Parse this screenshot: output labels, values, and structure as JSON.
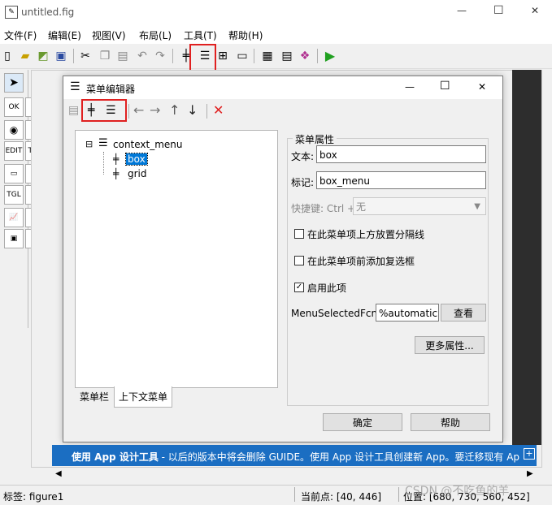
{
  "window": {
    "title": "untitled.fig",
    "minimize": "—",
    "maximize": "☐",
    "close": "✕"
  },
  "menubar": [
    {
      "label": "文件(F)"
    },
    {
      "label": "编辑(E)"
    },
    {
      "label": "视图(V)"
    },
    {
      "label": "布局(L)"
    },
    {
      "label": "工具(T)"
    },
    {
      "label": "帮助(H)"
    }
  ],
  "dialog": {
    "title": "菜单编辑器",
    "tree": {
      "root": "context_menu",
      "expander": "⊟",
      "children": [
        {
          "label": "box"
        },
        {
          "label": "grid"
        }
      ]
    },
    "tabs": {
      "menubar": "菜单栏",
      "context": "上下文菜单"
    },
    "group_title": "菜单属性",
    "text_label": "文本:",
    "text_value": "box",
    "tag_label": "标记:",
    "tag_value": "box_menu",
    "shortcut_label": "快捷键: Ctrl +",
    "shortcut_value": "无",
    "check1": "在此菜单项上方放置分隔线",
    "check2": "在此菜单项前添加复选框",
    "check3": "启用此项",
    "check3_checked": "✓",
    "callback_label": "MenuSelectedFcn:",
    "callback_value": "%automatic",
    "view_button": "查看",
    "more_button": "更多属性...",
    "ok_button": "确定",
    "help_button": "帮助"
  },
  "banner": {
    "bold": "使用 App 设计工具",
    "text": " - 以后的版本中将会删除 GUIDE。使用 App 设计工具创建新 App。要迁移现有 App..."
  },
  "status": {
    "tag": "标签: figure1",
    "point": "当前点:   [40, 446]",
    "position": "位置: [680, 730, 560, 452]"
  },
  "watermark": "CSDN @不吃鱼的羊",
  "colors": {
    "accent": "#1b6ec2",
    "highlight": "#e02020",
    "selection": "#0078d7"
  }
}
